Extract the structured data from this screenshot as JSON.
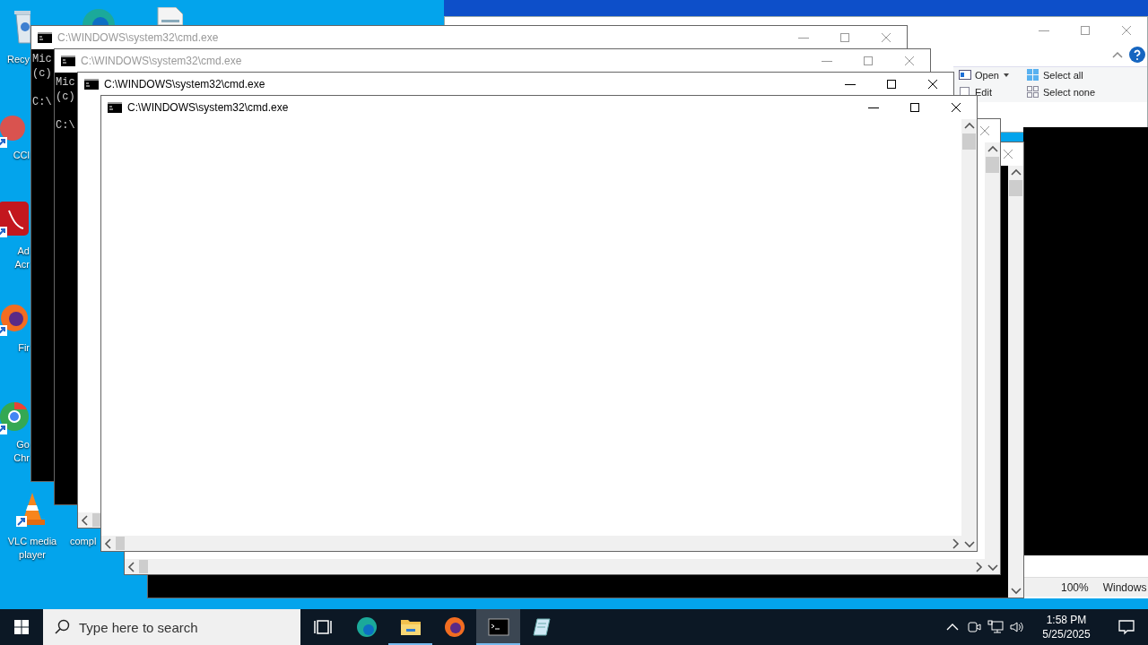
{
  "desktop_icons": [
    {
      "kind": "recycle",
      "lines": [
        "Recy"
      ]
    },
    {
      "kind": "ccleaner",
      "lines": [
        "CCl"
      ]
    },
    {
      "kind": "acrobat",
      "lines": [
        "Ad",
        "Acr"
      ]
    },
    {
      "kind": "firefox",
      "lines": [
        "Fir"
      ]
    },
    {
      "kind": "chrome",
      "lines": [
        "Go",
        "Chr"
      ]
    },
    {
      "kind": "vlc",
      "lines": [
        "VLC media",
        "player"
      ]
    },
    {
      "kind": "edge"
    },
    {
      "kind": "document"
    },
    {
      "kind": "file",
      "lines": [
        "compl"
      ]
    }
  ],
  "explorer_window": {
    "ribbon": [
      {
        "kind": "open",
        "label": "Open",
        "dropdown": true
      },
      {
        "kind": "edit",
        "label": "Edit",
        "dropdown": false
      },
      {
        "kind": "selectall",
        "label": "Select all",
        "dropdown": false
      },
      {
        "kind": "selectnone",
        "label": "Select none",
        "dropdown": false
      }
    ]
  },
  "console_windows": [
    {
      "title": "C:\\WINDOWS\\system32\\cmd.exe",
      "active": false,
      "dark": true,
      "lines": [
        "Mic",
        "(c)",
        "C:\\"
      ]
    },
    {
      "title": "C:\\WINDOWS\\system32\\cmd.exe",
      "active": false,
      "dark": true,
      "lines": [
        "Mic",
        "(c)",
        "C:\\"
      ]
    },
    {
      "title": "C:\\WINDOWS\\system32\\cmd.exe",
      "active": true,
      "dark": false
    },
    {
      "title": "C:\\WINDOWS\\system32\\cmd.exe",
      "active": true,
      "dark": false
    },
    {
      "active": false,
      "dark": false
    },
    {
      "active": false,
      "dark": true
    }
  ],
  "notepad_status": [
    "100%",
    "Windows"
  ],
  "taskbar": {
    "search": {
      "placeholder": "Type here to search"
    },
    "apps": [
      {
        "kind": "taskview",
        "selected": false,
        "open": false
      },
      {
        "kind": "edge",
        "selected": false,
        "open": false
      },
      {
        "kind": "explorer",
        "selected": false,
        "open": true
      },
      {
        "kind": "firefox",
        "selected": false,
        "open": false
      },
      {
        "kind": "cmd",
        "selected": true,
        "open": true
      },
      {
        "kind": "notepad",
        "selected": false,
        "open": false
      }
    ],
    "clock": {
      "time": "1:58 PM",
      "date": "5/25/2025"
    }
  }
}
